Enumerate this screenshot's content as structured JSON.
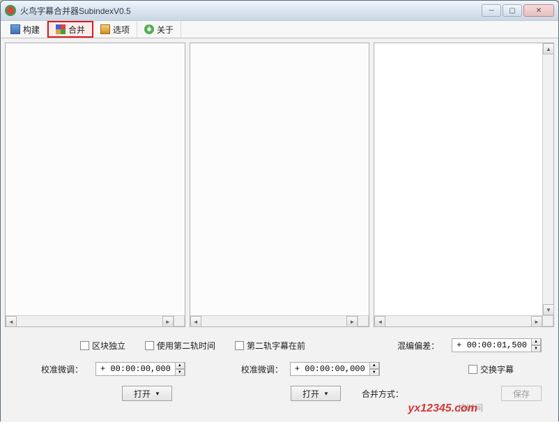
{
  "window": {
    "title": "火鸟字幕合并器SubindexV0.5"
  },
  "tabs": {
    "build": "构建",
    "merge": "合并",
    "options": "选项",
    "about": "关于"
  },
  "checks": {
    "block_independent": "区块独立",
    "use_track2_time": "使用第二轨时间",
    "track2_first": "第二轨字幕在前",
    "swap_subs": "交换字幕"
  },
  "labels": {
    "mix_offset": "混编偏差：",
    "calib_adj": "校准微调：",
    "merge_mode": "合并方式：",
    "open": "打开",
    "save": "保存"
  },
  "values": {
    "mix_offset": "+ 00:00:01,500",
    "calib_adj_left": "+ 00:00:00,000",
    "calib_adj_right": "+ 00:00:00,000",
    "merge_mode_hidden": "按时间"
  },
  "watermark": "yx12345.com"
}
